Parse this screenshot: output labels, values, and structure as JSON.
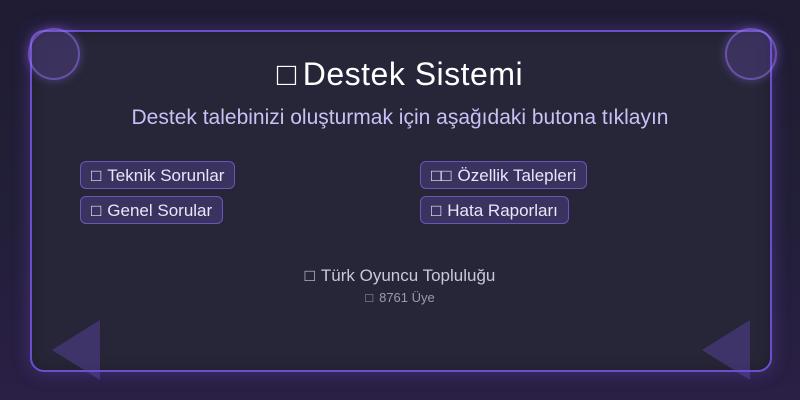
{
  "header": {
    "title_icon": "□",
    "title": "Destek Sistemi",
    "subtitle": "Destek talebinizi oluşturmak için aşağıdaki butona tıklayın"
  },
  "categories": [
    {
      "icon": "□",
      "label": "Teknik Sorunlar"
    },
    {
      "icon": "□",
      "label": "Genel Sorular"
    },
    {
      "icon": "□□",
      "label": "Özellik Talepleri"
    },
    {
      "icon": "□",
      "label": "Hata Raporları"
    }
  ],
  "footer": {
    "community_icon": "□",
    "community_name": "Türk Oyuncu Topluluğu",
    "members_icon": "□",
    "members_text": "8761 Üye"
  },
  "colors": {
    "accent": "#6b4fc9",
    "card_bg": "#262638",
    "button_bg": "#3a3360",
    "subtitle": "#c7c1f5"
  }
}
